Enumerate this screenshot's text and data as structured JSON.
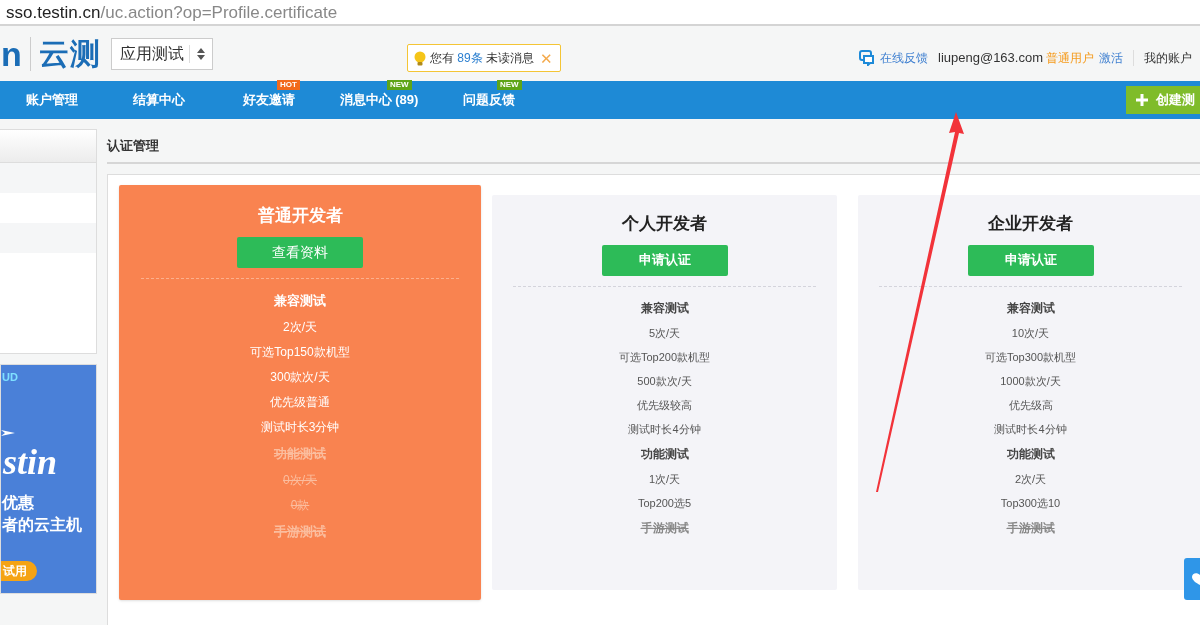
{
  "address_bar": {
    "host": "sso.testin.cn",
    "path": "/uc.action?op=Profile.certificate"
  },
  "header": {
    "logo_cut": "n",
    "logo": "云测",
    "product_select": "应用测试",
    "notice": {
      "before": "您有",
      "count": "89条",
      "after": "未读消息",
      "close": "✕"
    },
    "feedback": "在线反馈",
    "email": "liupeng@163.com",
    "user_level": "普通用户",
    "activate": "激活",
    "account": "我的账户"
  },
  "nav": [
    {
      "label": "账户管理"
    },
    {
      "label": "结算中心"
    },
    {
      "label": "好友邀请",
      "badge": {
        "text": "HOT",
        "color": "#f26a1b"
      }
    },
    {
      "label": "消息中心 (89)",
      "badge": {
        "text": "NEW",
        "color": "#5ea518"
      }
    },
    {
      "label": "问题反馈",
      "badge": {
        "text": "NEW",
        "color": "#5ea518"
      }
    }
  ],
  "create_button": "创建测",
  "banner": {
    "tag": "UD",
    "brand": "stin",
    "lines": [
      "优惠",
      "者的云主机"
    ],
    "button": "试用"
  },
  "section_title": "认证管理",
  "cards": [
    {
      "title": "普通开发者",
      "button": "查看资料",
      "selected": true,
      "features": [
        {
          "kind": "heading",
          "text": "兼容测试",
          "disabled": false
        },
        {
          "kind": "item",
          "text": "2次/天",
          "disabled": false
        },
        {
          "kind": "item",
          "text": "可选Top150款机型",
          "disabled": false
        },
        {
          "kind": "item",
          "text": "300款次/天",
          "disabled": false
        },
        {
          "kind": "item",
          "text": "优先级普通",
          "disabled": false
        },
        {
          "kind": "item",
          "text": "测试时长3分钟",
          "disabled": false
        },
        {
          "kind": "heading",
          "text": "功能测试",
          "disabled": true
        },
        {
          "kind": "item",
          "text": "0次/天",
          "disabled": true
        },
        {
          "kind": "item",
          "text": "0款",
          "disabled": true
        },
        {
          "kind": "heading",
          "text": "手游测试",
          "disabled": true
        }
      ]
    },
    {
      "title": "个人开发者",
      "button": "申请认证",
      "selected": false,
      "features": [
        {
          "kind": "heading",
          "text": "兼容测试",
          "disabled": false
        },
        {
          "kind": "item",
          "text": "5次/天",
          "disabled": false
        },
        {
          "kind": "item",
          "text": "可选Top200款机型",
          "disabled": false
        },
        {
          "kind": "item",
          "text": "500款次/天",
          "disabled": false
        },
        {
          "kind": "item",
          "text": "优先级较高",
          "disabled": false
        },
        {
          "kind": "item",
          "text": "测试时长4分钟",
          "disabled": false
        },
        {
          "kind": "heading",
          "text": "功能测试",
          "disabled": false
        },
        {
          "kind": "item",
          "text": "1次/天",
          "disabled": false
        },
        {
          "kind": "item",
          "text": "Top200选5",
          "disabled": false
        },
        {
          "kind": "heading",
          "text": "手游测试",
          "disabled": true
        }
      ]
    },
    {
      "title": "企业开发者",
      "button": "申请认证",
      "selected": false,
      "features": [
        {
          "kind": "heading",
          "text": "兼容测试",
          "disabled": false
        },
        {
          "kind": "item",
          "text": "10次/天",
          "disabled": false
        },
        {
          "kind": "item",
          "text": "可选Top300款机型",
          "disabled": false
        },
        {
          "kind": "item",
          "text": "1000款次/天",
          "disabled": false
        },
        {
          "kind": "item",
          "text": "优先级高",
          "disabled": false
        },
        {
          "kind": "item",
          "text": "测试时长4分钟",
          "disabled": false
        },
        {
          "kind": "heading",
          "text": "功能测试",
          "disabled": false
        },
        {
          "kind": "item",
          "text": "2次/天",
          "disabled": false
        },
        {
          "kind": "item",
          "text": "Top300选10",
          "disabled": false
        },
        {
          "kind": "heading",
          "text": "手游测试",
          "disabled": true
        }
      ]
    }
  ]
}
